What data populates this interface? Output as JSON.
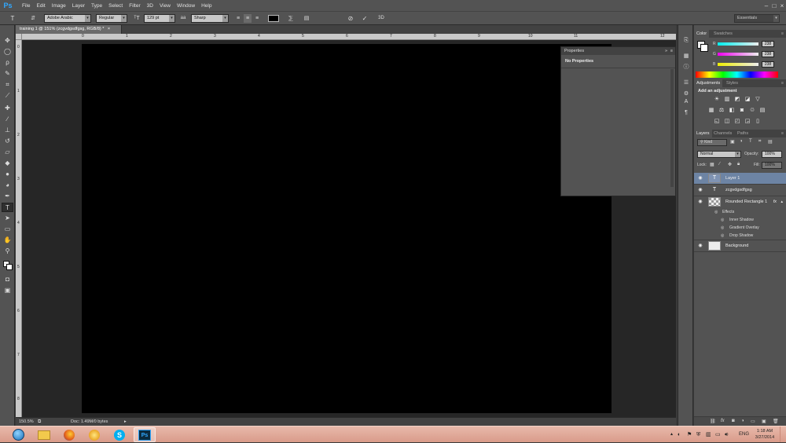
{
  "app": {
    "logo": "Ps"
  },
  "menu": [
    "File",
    "Edit",
    "Image",
    "Layer",
    "Type",
    "Select",
    "Filter",
    "3D",
    "View",
    "Window",
    "Help"
  ],
  "window_controls": [
    "–",
    "□",
    "×"
  ],
  "options_bar": {
    "font_family": "Adobe Arabic",
    "font_style": "Regular",
    "font_size": "129 pt",
    "antialias_prefix": "aa",
    "antialias": "Sharp",
    "threed_label": "3D",
    "workspace": "Essentials",
    "text_color": "#000000"
  },
  "document": {
    "tab_title": "training 1 @ 151% (zcgvdgsdfgsg, RGB/8) *",
    "close": "×",
    "ruler_marks": [
      "0",
      "1",
      "2",
      "3",
      "4",
      "5",
      "6",
      "7",
      "8",
      "9",
      "10",
      "11",
      "12"
    ],
    "v_ruler_marks": [
      "0",
      "1",
      "2",
      "3",
      "4",
      "5",
      "6",
      "7",
      "8"
    ],
    "zoom": "150.5%",
    "doc_info": "Doc: 1.49M/0 bytes"
  },
  "properties_panel": {
    "title": "Properties",
    "content": "No Properties"
  },
  "color_panel": {
    "tabs": [
      "Color",
      "Swatches"
    ],
    "channels": [
      {
        "label": "R",
        "value": "238"
      },
      {
        "label": "G",
        "value": "238"
      },
      {
        "label": "B",
        "value": "238"
      }
    ]
  },
  "adjustments_panel": {
    "tabs": [
      "Adjustments",
      "Styles"
    ],
    "heading": "Add an adjustment"
  },
  "layers_panel": {
    "tabs": [
      "Layers",
      "Channels",
      "Paths"
    ],
    "filter": "Kind",
    "blend_mode": "Normal",
    "opacity_label": "Opacity:",
    "opacity": "100%",
    "lock_label": "Lock:",
    "fill_label": "Fill:",
    "fill": "100%",
    "layers": [
      {
        "name": "Layer 1",
        "type": "text",
        "selected": true
      },
      {
        "name": "zcgvdgsdfgsg",
        "type": "text",
        "selected": false
      },
      {
        "name": "Rounded Rectangle 1",
        "type": "shape",
        "selected": false,
        "fx": "fx"
      },
      {
        "name": "Background",
        "type": "image",
        "selected": false
      }
    ],
    "effects_label": "Effects",
    "effects": [
      "Inner Shadow",
      "Gradient Overlay",
      "Drop Shadow"
    ]
  },
  "taskbar": {
    "lang": "ENG",
    "time": "1:18 AM",
    "date": "3/27/2014",
    "ps_label": "Ps"
  }
}
